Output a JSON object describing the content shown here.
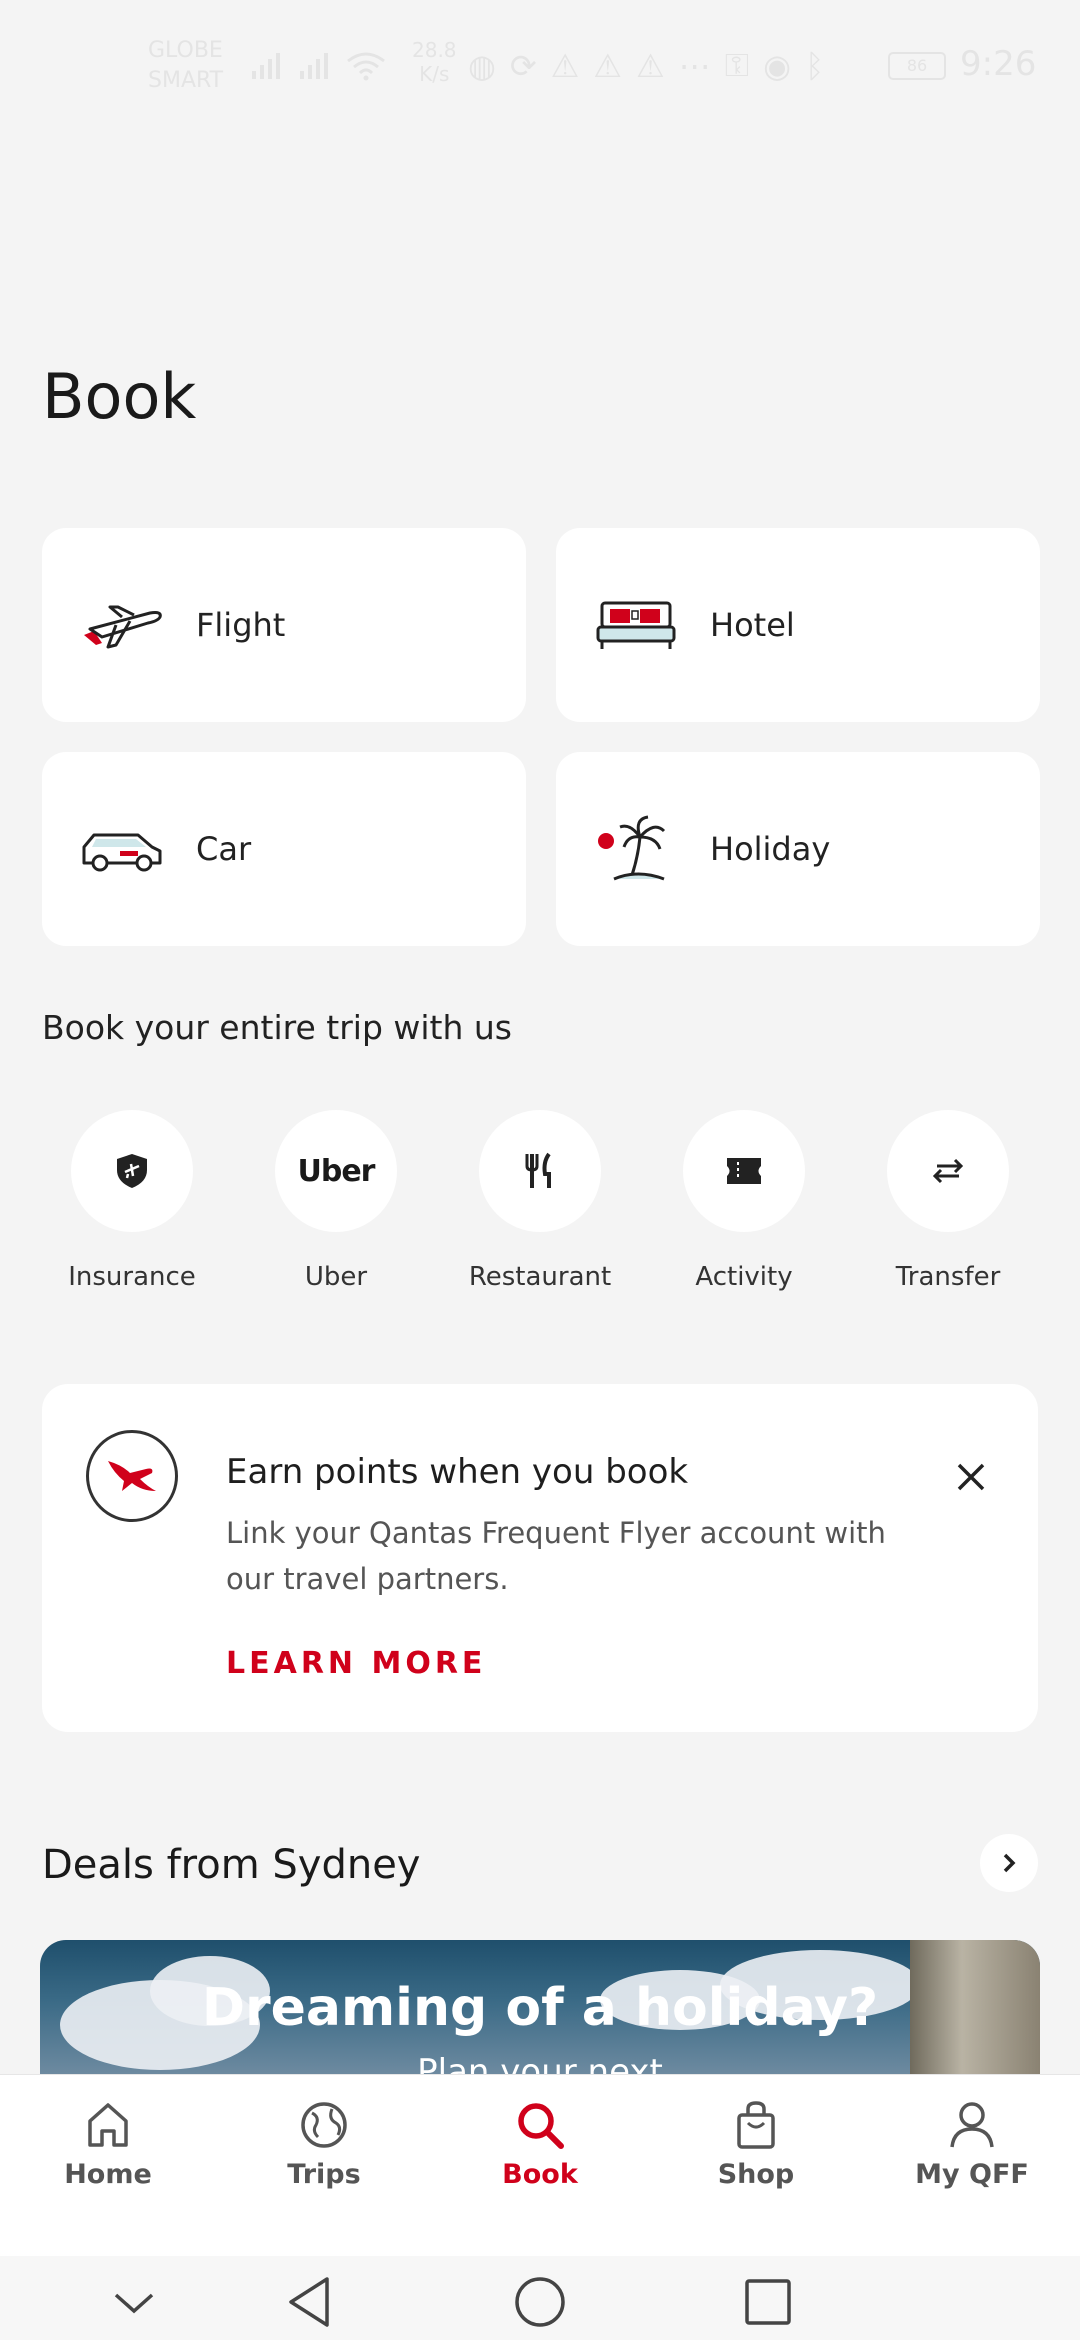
{
  "status_bar": {
    "carrier_line1": "GLOBE",
    "carrier_line2": "SMART",
    "speed_value": "28.8",
    "speed_unit": "K/s",
    "battery": "86",
    "time": "9:26"
  },
  "page_title": "Book",
  "booking_tiles": [
    {
      "label": "Flight",
      "icon": "plane-icon"
    },
    {
      "label": "Hotel",
      "icon": "bed-icon"
    },
    {
      "label": "Car",
      "icon": "car-icon"
    },
    {
      "label": "Holiday",
      "icon": "palm-tree-icon"
    }
  ],
  "extras_heading": "Book your entire trip with us",
  "extras": [
    {
      "label": "Insurance",
      "icon": "shield-plane-icon"
    },
    {
      "label": "Uber",
      "icon_text": "Uber"
    },
    {
      "label": "Restaurant",
      "icon": "cutlery-icon"
    },
    {
      "label": "Activity",
      "icon": "ticket-icon"
    },
    {
      "label": "Transfer",
      "icon": "swap-arrows-icon"
    }
  ],
  "promo": {
    "title": "Earn points when you book",
    "body": "Link your Qantas Frequent Flyer account with our travel partners.",
    "link": "LEARN MORE"
  },
  "deals": {
    "title": "Deals from Sydney",
    "banner_title": "Dreaming of a holiday?",
    "banner_subtitle": "Plan your next"
  },
  "tabs": [
    {
      "label": "Home",
      "icon": "home-icon",
      "active": false
    },
    {
      "label": "Trips",
      "icon": "globe-icon",
      "active": false
    },
    {
      "label": "Book",
      "icon": "search-icon",
      "active": true
    },
    {
      "label": "Shop",
      "icon": "shopping-bag-icon",
      "active": false
    },
    {
      "label": "My QFF",
      "icon": "person-icon",
      "active": false
    }
  ],
  "colors": {
    "accent": "#d0011b",
    "background": "#f4f4f4",
    "card": "#ffffff"
  }
}
